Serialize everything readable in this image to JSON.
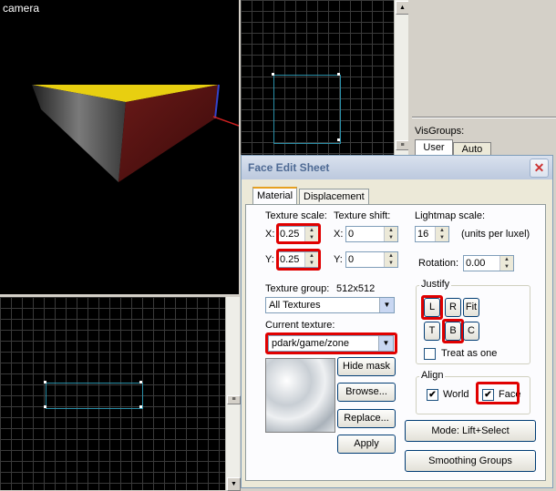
{
  "viewport3d": {
    "label": "camera"
  },
  "right_panel": {
    "visgroups_label": "VisGroups:",
    "tabs": [
      "User",
      "Auto"
    ]
  },
  "dialog": {
    "title": "Face Edit Sheet",
    "close_glyph": "✕",
    "tabs": [
      "Material",
      "Displacement"
    ],
    "texture_scale": {
      "label": "Texture scale:",
      "x_label": "X:",
      "x_value": "0.25",
      "y_label": "Y:",
      "y_value": "0.25"
    },
    "texture_shift": {
      "label": "Texture shift:",
      "x_label": "X:",
      "x_value": "0",
      "y_label": "Y:",
      "y_value": "0"
    },
    "lightmap": {
      "label": "Lightmap scale:",
      "value": "16",
      "units": "(units per luxel)"
    },
    "rotation": {
      "label": "Rotation:",
      "value": "0.00"
    },
    "texture_group": {
      "label": "Texture group:",
      "size": "512x512",
      "value": "All Textures"
    },
    "current_texture": {
      "label": "Current texture:",
      "value": "pdark/game/zone"
    },
    "buttons": {
      "hide_mask": "Hide mask",
      "browse": "Browse...",
      "replace": "Replace...",
      "apply": "Apply"
    },
    "justify": {
      "label": "Justify",
      "L": "L",
      "R": "R",
      "Fit": "Fit",
      "T": "T",
      "B": "B",
      "C": "C",
      "treat_as_one": "Treat as one"
    },
    "align": {
      "label": "Align",
      "world": "World",
      "face": "Face",
      "world_checked": true,
      "face_checked": true
    },
    "mode_button": "Mode: Lift+Select",
    "smoothing_button": "Smoothing Groups",
    "check_glyph": "✔"
  },
  "colors": {
    "highlight": "#e00000",
    "selection": "#2a8fa8",
    "title_text": "#4e6a94"
  }
}
